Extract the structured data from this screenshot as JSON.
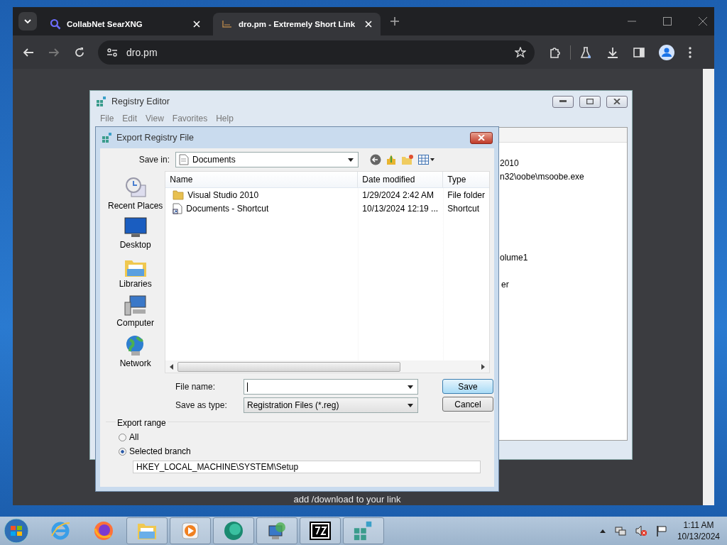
{
  "browser": {
    "tabs": [
      {
        "title": "CollabNet SearXNG",
        "selected": false
      },
      {
        "title": "dro.pm - Extremely Short Link",
        "selected": true
      }
    ],
    "address": "dro.pm",
    "page_text": "add /download to your link"
  },
  "registry_editor": {
    "title": "Registry Editor",
    "menu": [
      "File",
      "Edit",
      "View",
      "Favorites",
      "Help"
    ],
    "visible_text": [
      "2010",
      "n32\\oobe\\msoobe.exe",
      "olume1",
      "er"
    ]
  },
  "dialog": {
    "title": "Export Registry File",
    "save_in_label": "Save in:",
    "save_in": "Documents",
    "places": [
      {
        "label": "Recent Places",
        "kind": "recent"
      },
      {
        "label": "Desktop",
        "kind": "desktop"
      },
      {
        "label": "Libraries",
        "kind": "libraries"
      },
      {
        "label": "Computer",
        "kind": "computer"
      },
      {
        "label": "Network",
        "kind": "network"
      }
    ],
    "columns": [
      "Name",
      "Date modified",
      "Type"
    ],
    "files": [
      {
        "name": "Visual Studio 2010",
        "date": "1/29/2024 2:42 AM",
        "type": "File folder",
        "kind": "folder"
      },
      {
        "name": "Documents - Shortcut",
        "date": "10/13/2024 12:19 ...",
        "type": "Shortcut",
        "kind": "shortcut"
      }
    ],
    "file_name_label": "File name:",
    "save_as_type_label": "Save as type:",
    "save_as_type": "Registration Files (*.reg)",
    "buttons": [
      {
        "label": "Save",
        "default": true
      },
      {
        "label": "Cancel",
        "default": false
      }
    ],
    "export_range": {
      "label": "Export range",
      "options": [
        {
          "label": "All",
          "selected": false
        },
        {
          "label": "Selected branch",
          "selected": true
        }
      ],
      "branch": "HKEY_LOCAL_MACHINE\\SYSTEM\\Setup"
    }
  },
  "taskbar": {
    "time": "1:11 AM",
    "date": "10/13/2024"
  }
}
